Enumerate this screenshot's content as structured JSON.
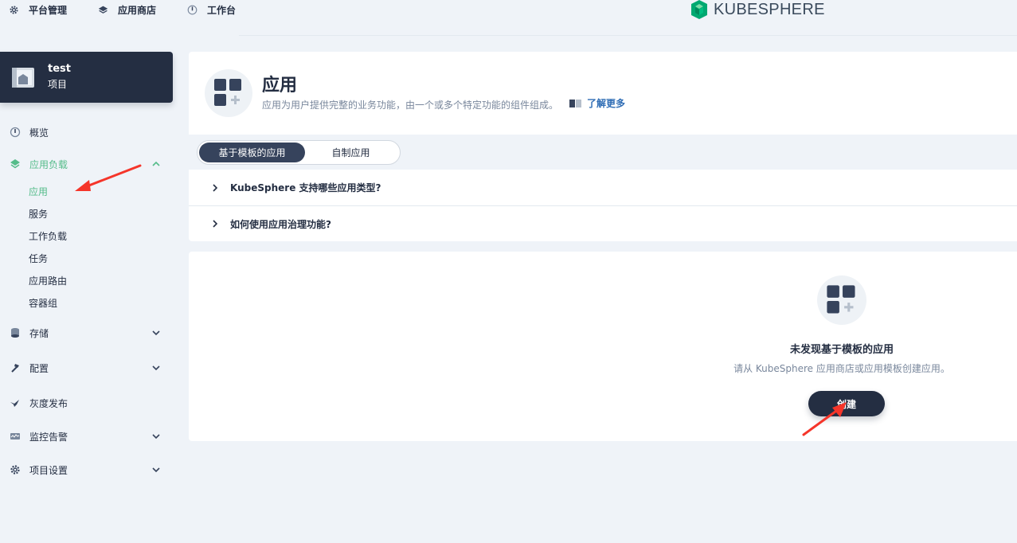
{
  "topnav": {
    "items": [
      {
        "label": "平台管理",
        "icon": "gear-icon"
      },
      {
        "label": "应用商店",
        "icon": "layers-icon"
      },
      {
        "label": "工作台",
        "icon": "dashboard-icon"
      }
    ],
    "logo_text": "KUBESPHERE"
  },
  "project": {
    "name": "test",
    "type": "项目"
  },
  "sidebar": {
    "overview": "概览",
    "workloads": {
      "label": "应用负载",
      "sub": [
        "应用",
        "服务",
        "工作负载",
        "任务",
        "应用路由",
        "容器组"
      ]
    },
    "storage": "存储",
    "config": "配置",
    "gray_release": "灰度发布",
    "monitoring": "监控告警",
    "project_settings": "项目设置"
  },
  "header": {
    "title": "应用",
    "description": "应用为用户提供完整的业务功能，由一个或多个特定功能的组件组成。",
    "learn_more": "了解更多"
  },
  "tabs": {
    "template": "基于模板的应用",
    "custom": "自制应用"
  },
  "faq": [
    "KubeSphere 支持哪些应用类型?",
    "如何使用应用治理功能?"
  ],
  "empty": {
    "title": "未发现基于模板的应用",
    "description": "请从 KubeSphere 应用商店或应用模板创建应用。",
    "create_label": "创建"
  },
  "colors": {
    "accent": "#55bc8a",
    "dark": "#242e42",
    "annotation_arrow": "#f5352a"
  }
}
